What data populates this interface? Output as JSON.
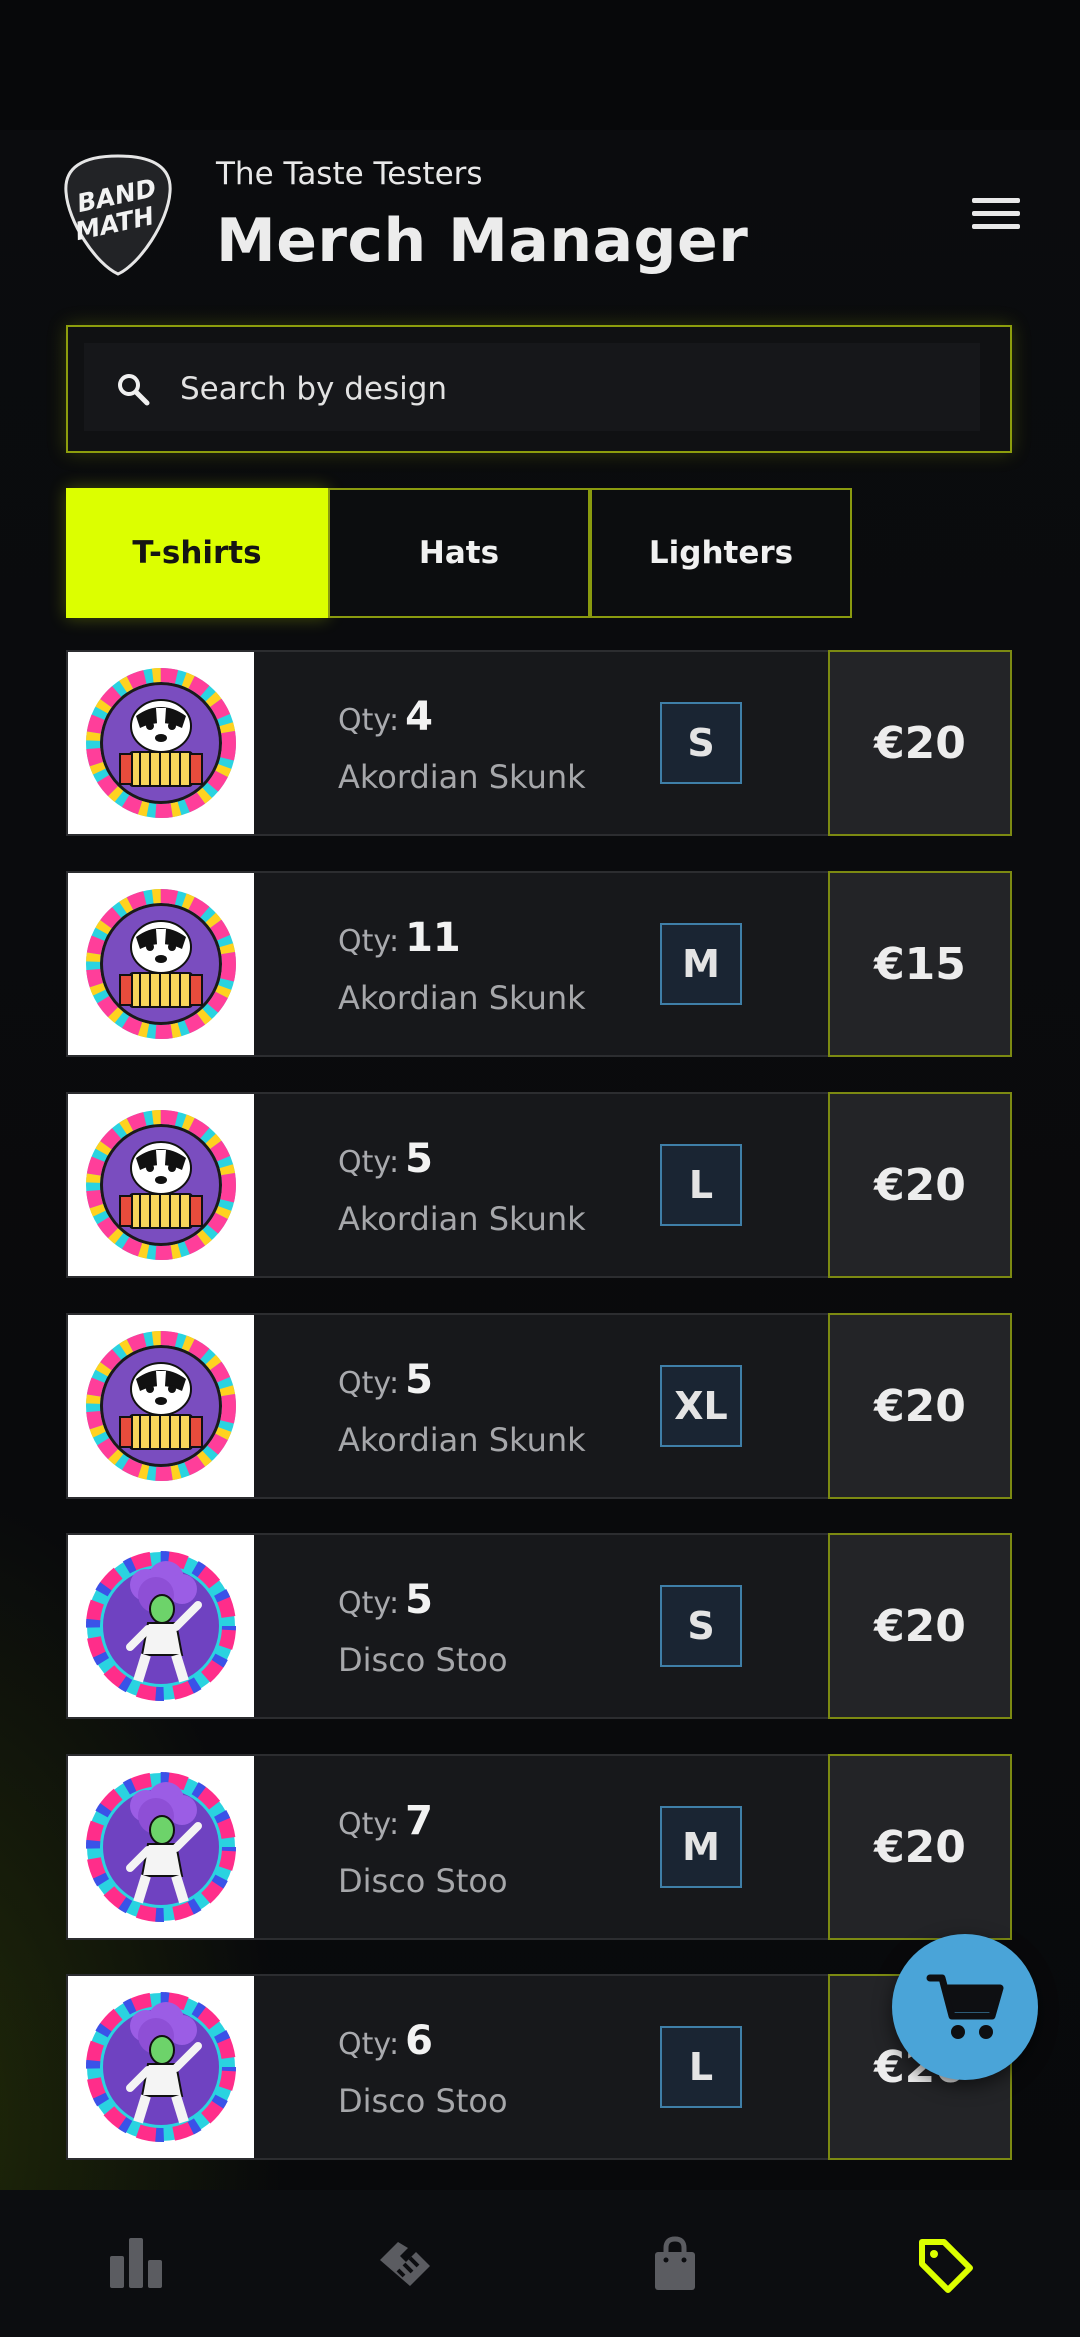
{
  "header": {
    "logo_text_top": "BAND",
    "logo_text_bottom": "MATH",
    "band_name": "The Taste Testers",
    "title": "Merch Manager",
    "menu_icon": "hamburger-menu-icon"
  },
  "search": {
    "placeholder": "Search by design",
    "value": "",
    "icon": "search-icon"
  },
  "tabs": [
    {
      "label": "T-shirts",
      "active": true
    },
    {
      "label": "Hats",
      "active": false
    },
    {
      "label": "Lighters",
      "active": false
    }
  ],
  "items": [
    {
      "qty_label": "Qty:",
      "qty": "4",
      "design": "Akordian Skunk",
      "size": "S",
      "price": "€20"
    },
    {
      "qty_label": "Qty:",
      "qty": "11",
      "design": "Akordian Skunk",
      "size": "M",
      "price": "€15"
    },
    {
      "qty_label": "Qty:",
      "qty": "5",
      "design": "Akordian Skunk",
      "size": "L",
      "price": "€20"
    },
    {
      "qty_label": "Qty:",
      "qty": "5",
      "design": "Akordian Skunk",
      "size": "XL",
      "price": "€20"
    },
    {
      "qty_label": "Qty:",
      "qty": "5",
      "design": "Disco Stoo",
      "size": "S",
      "price": "€20"
    },
    {
      "qty_label": "Qty:",
      "qty": "7",
      "design": "Disco Stoo",
      "size": "M",
      "price": "€20"
    },
    {
      "qty_label": "Qty:",
      "qty": "6",
      "design": "Disco Stoo",
      "size": "L",
      "price": "€20"
    }
  ],
  "cart_fab": {
    "icon": "shopping-cart-icon"
  },
  "bottom_nav": [
    {
      "icon": "bar-chart-icon",
      "active": false
    },
    {
      "icon": "handshake-icon",
      "active": false
    },
    {
      "icon": "shopping-bag-icon",
      "active": false
    },
    {
      "icon": "price-tag-icon",
      "active": true
    }
  ],
  "colors": {
    "accent": "#dcff00",
    "background": "#08090b",
    "size_badge_border": "#3f7fa8",
    "cart_fab": "#4aa4d8"
  }
}
